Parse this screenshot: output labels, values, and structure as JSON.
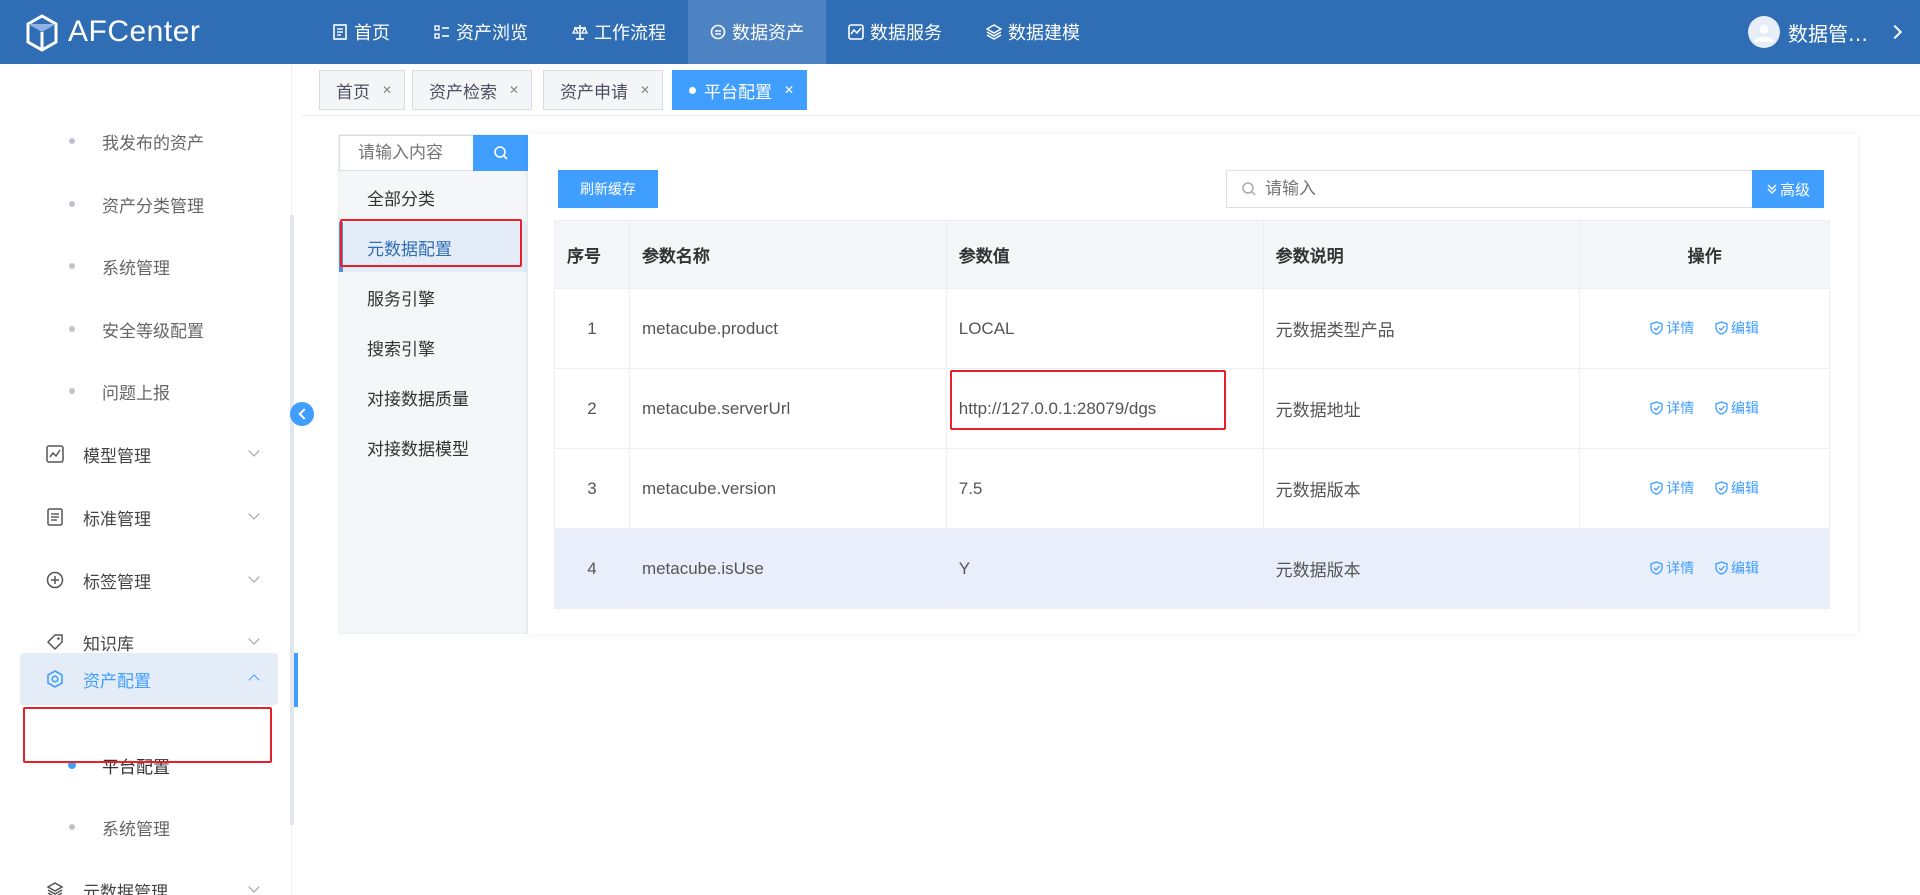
{
  "app": {
    "name": "AFCenter"
  },
  "nav": [
    {
      "label": "首页",
      "icon": "document-icon",
      "active": false
    },
    {
      "label": "资产浏览",
      "icon": "list-icon",
      "active": false
    },
    {
      "label": "工作流程",
      "icon": "flow-icon",
      "active": false
    },
    {
      "label": "数据资产",
      "icon": "data-asset-icon",
      "active": true
    },
    {
      "label": "数据服务",
      "icon": "service-icon",
      "active": false
    },
    {
      "label": "数据建模",
      "icon": "layers-icon",
      "active": false
    }
  ],
  "user": {
    "name": "数据管…"
  },
  "sidebar": {
    "sub_items_top": [
      "我发布的资产",
      "资产分类管理",
      "系统管理",
      "安全等级配置",
      "问题上报"
    ],
    "groups": [
      {
        "label": "模型管理",
        "icon": "chart-line-icon"
      },
      {
        "label": "标准管理",
        "icon": "file-text-icon"
      },
      {
        "label": "标签管理",
        "icon": "plus-circle-icon"
      },
      {
        "label": "知识库",
        "icon": "tag-icon"
      },
      {
        "label": "资产配置",
        "icon": "settings-icon"
      }
    ],
    "open_sub_items": [
      {
        "label": "平台配置",
        "active": true
      },
      {
        "label": "系统管理",
        "active": false
      }
    ],
    "last_group": {
      "label": "元数据管理",
      "icon": "layers-icon"
    }
  },
  "tabs": [
    {
      "label": "首页",
      "active": false
    },
    {
      "label": "资产检索",
      "active": false
    },
    {
      "label": "资产申请",
      "active": false
    },
    {
      "label": "平台配置",
      "active": true
    }
  ],
  "category": {
    "search_placeholder": "请输入内容",
    "items": [
      "全部分类",
      "元数据配置",
      "服务引擎",
      "搜索引擎",
      "对接数据质量",
      "对接数据模型"
    ],
    "active_index": 1
  },
  "toolbar": {
    "refresh_label": "刷新缓存",
    "search_placeholder": "请输入",
    "advanced_label": "高级"
  },
  "table": {
    "headers": [
      "序号",
      "参数名称",
      "参数值",
      "参数说明",
      "操作"
    ],
    "rows": [
      {
        "index": "1",
        "name": "metacube.product",
        "value": "LOCAL",
        "desc": "元数据类型产品"
      },
      {
        "index": "2",
        "name": "metacube.serverUrl",
        "value": "http://127.0.0.1:28079/dgs",
        "desc": "元数据地址"
      },
      {
        "index": "3",
        "name": "metacube.version",
        "value": "7.5",
        "desc": "元数据版本"
      },
      {
        "index": "4",
        "name": "metacube.isUse",
        "value": "Y",
        "desc": "元数据版本"
      }
    ],
    "action_detail": "详情",
    "action_edit": "编辑"
  },
  "colors": {
    "topbar": "#2f6db5",
    "accent": "#409eff",
    "highlight_box": "#e8202a"
  }
}
